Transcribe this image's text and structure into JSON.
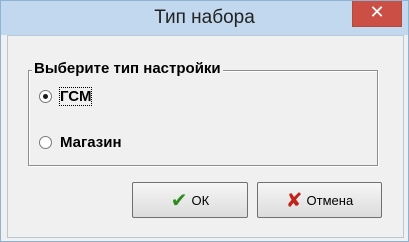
{
  "window": {
    "title": "Тип набора",
    "close_glyph": "✕"
  },
  "group": {
    "caption": "Выберите тип настройки",
    "options": [
      {
        "label": "ГСМ",
        "selected": true
      },
      {
        "label": "Магазин",
        "selected": false
      }
    ]
  },
  "buttons": {
    "ok": {
      "label": "ОК",
      "icon": "checkmark-icon",
      "icon_glyph": "✔",
      "icon_color": "#2e8b1e"
    },
    "cancel": {
      "label": "Отмена",
      "icon": "x-icon",
      "icon_glyph": "✘",
      "icon_color": "#c0231a"
    }
  },
  "colors": {
    "titlebar": "#c2d8ee",
    "close_button": "#cb4f44"
  }
}
